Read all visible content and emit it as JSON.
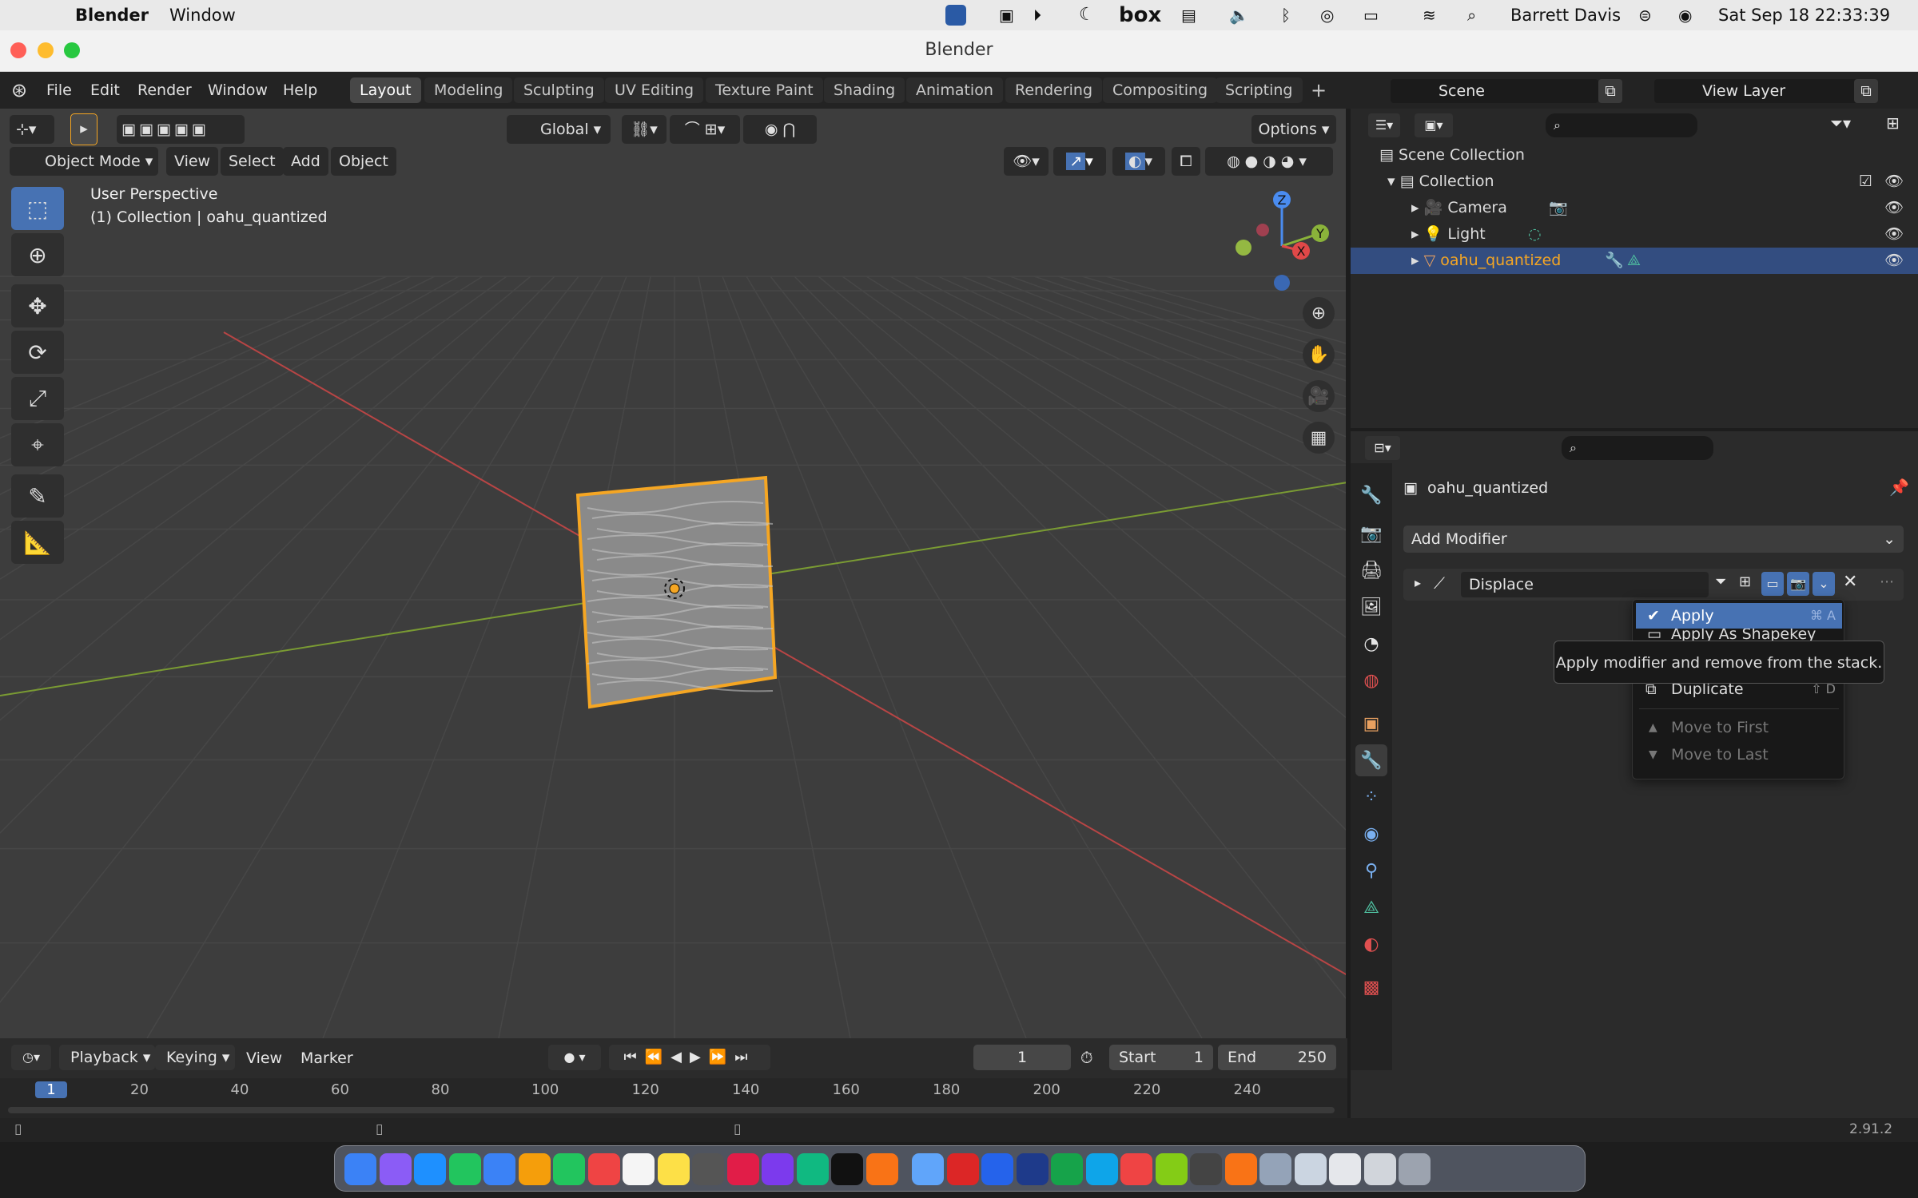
{
  "mac_menu": {
    "app": "Blender",
    "window": "Window",
    "box_label": "box",
    "user": "Barrett Davis",
    "clock": "Sat Sep 18  22:33:39"
  },
  "window_title": "Blender",
  "top_menu": [
    "File",
    "Edit",
    "Render",
    "Window",
    "Help"
  ],
  "workspaces": [
    "Layout",
    "Modeling",
    "Sculpting",
    "UV Editing",
    "Texture Paint",
    "Shading",
    "Animation",
    "Rendering",
    "Compositing",
    "Scripting"
  ],
  "active_workspace": "Layout",
  "scene": {
    "name": "Scene",
    "view_layer": "View Layer"
  },
  "viewport": {
    "transform_orientation": "Global",
    "options_label": "Options",
    "mode": "Object Mode",
    "menus": [
      "View",
      "Select",
      "Add",
      "Object"
    ],
    "info_line1": "User Perspective",
    "info_line2": "(1) Collection | oahu_quantized",
    "gizmo_axes": {
      "z": "Z",
      "y": "Y",
      "x": "X"
    }
  },
  "outliner": {
    "root": "Scene Collection",
    "collection": "Collection",
    "items": [
      "Camera",
      "Light",
      "oahu_quantized"
    ],
    "selected": "oahu_quantized"
  },
  "properties": {
    "object_name": "oahu_quantized",
    "add_modifier_label": "Add Modifier",
    "modifier_name": "Displace"
  },
  "dropdown": {
    "apply": "Apply",
    "apply_shortcut": "⌘ A",
    "apply_shape": "Apply As Shapekey",
    "duplicate": "Duplicate",
    "duplicate_shortcut": "⇧ D",
    "move_first": "Move to First",
    "move_last": "Move to Last"
  },
  "tooltip": "Apply modifier and remove from the stack.",
  "timeline": {
    "menus": [
      "Playback",
      "Keying",
      "View",
      "Marker"
    ],
    "current_frame": "1",
    "start_label": "Start",
    "start": "1",
    "end_label": "End",
    "end": "250",
    "ruler_labels": [
      "1",
      "20",
      "40",
      "60",
      "80",
      "100",
      "120",
      "140",
      "160",
      "180",
      "200",
      "220",
      "240"
    ]
  },
  "version": "2.91.2",
  "colors": {
    "accent": "#4772b3",
    "selection_outline": "#f5a623",
    "bg": "#3d3d3d"
  }
}
